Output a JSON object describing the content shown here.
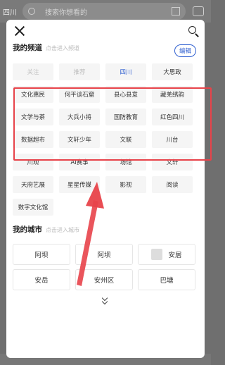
{
  "background": {
    "city": "四川",
    "search_placeholder": "搜索你想看的"
  },
  "modal": {
    "my_channels": {
      "title": "我的频道",
      "hint": "点击进入频道",
      "edit_label": "编辑",
      "items": [
        "关注",
        "推荐",
        "四川",
        "大思政",
        "文化惠民",
        "何平谈石窟",
        "县心县意",
        "藏羌绣韵",
        "文学与茶",
        "大兵小将",
        "国防教育",
        "红色四川",
        "数据超市",
        "文轩少年",
        "文联",
        "川台",
        "川观",
        "AI赛事",
        "场馆",
        "文轩",
        "天府艺展",
        "星星传媒",
        "影视",
        "阅读",
        "数字文化馆"
      ]
    },
    "my_cities": {
      "title": "我的城市",
      "hint": "点击进入城市",
      "items": [
        "阿坝",
        "阿坝",
        "安居",
        "安岳",
        "安州区",
        "巴塘"
      ]
    }
  },
  "colors": {
    "accent": "#2f5fd0",
    "annotation": "#e8434a"
  }
}
